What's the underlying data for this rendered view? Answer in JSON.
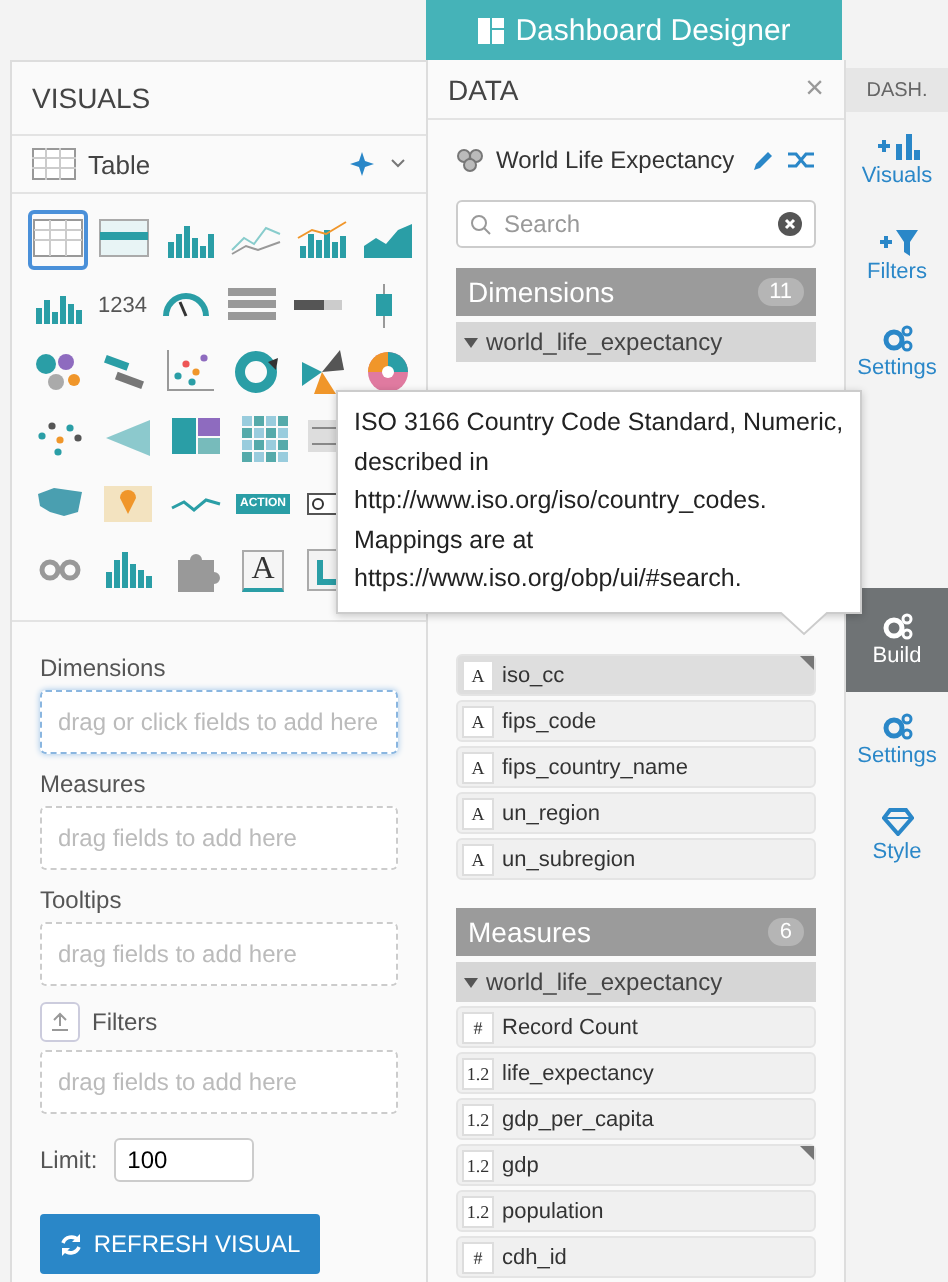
{
  "header": {
    "title": "Dashboard Designer"
  },
  "visuals_panel": {
    "title": "VISUALS",
    "current": "Table",
    "rows": [
      [
        {
          "kind": "table",
          "selected": true
        },
        {
          "kind": "cross-table",
          "selected": false
        },
        {
          "kind": "stacked-bars",
          "selected": false
        },
        {
          "kind": "lines",
          "selected": false
        },
        {
          "kind": "combo",
          "selected": false
        },
        {
          "kind": "area",
          "selected": false
        }
      ],
      [
        {
          "kind": "bars",
          "selected": false
        },
        {
          "kind": "kpi",
          "label": "1234",
          "selected": false
        },
        {
          "kind": "gauge",
          "selected": false
        },
        {
          "kind": "list",
          "selected": false
        },
        {
          "kind": "bullet",
          "selected": false
        },
        {
          "kind": "boxplot",
          "selected": false
        }
      ],
      [
        {
          "kind": "bubbles",
          "selected": false
        },
        {
          "kind": "word-cloud",
          "selected": false
        },
        {
          "kind": "scatter",
          "selected": false
        },
        {
          "kind": "donut",
          "selected": false
        },
        {
          "kind": "radial",
          "selected": false
        },
        {
          "kind": "sunburst",
          "selected": false
        }
      ],
      [
        {
          "kind": "network",
          "selected": false
        },
        {
          "kind": "funnel",
          "selected": false
        },
        {
          "kind": "treemap",
          "selected": false
        },
        {
          "kind": "heatmap",
          "selected": false
        },
        {
          "kind": "sankey",
          "selected": false
        }
      ],
      [
        {
          "kind": "map",
          "selected": false
        },
        {
          "kind": "pin-map",
          "selected": false
        },
        {
          "kind": "sparkline",
          "selected": false
        },
        {
          "kind": "action",
          "label": "ACTION",
          "selected": false
        },
        {
          "kind": "search-box",
          "selected": false
        }
      ],
      [
        {
          "kind": "chain",
          "selected": false
        },
        {
          "kind": "histogram",
          "selected": false
        },
        {
          "kind": "puzzle",
          "selected": false
        },
        {
          "kind": "rich-text",
          "label": "A",
          "selected": false
        },
        {
          "kind": "trellis",
          "selected": false
        }
      ]
    ],
    "shelves": [
      {
        "label": "Dimensions",
        "placeholder": "drag or click fields to add here",
        "focused": true,
        "kind": "plain"
      },
      {
        "label": "Measures",
        "placeholder": "drag fields to add here",
        "focused": false,
        "kind": "plain"
      },
      {
        "label": "Tooltips",
        "placeholder": "drag fields to add here",
        "focused": false,
        "kind": "plain"
      },
      {
        "label": "Filters",
        "placeholder": "drag fields to add here",
        "focused": false,
        "kind": "filter"
      }
    ],
    "limit": {
      "label": "Limit:",
      "value": "100"
    },
    "refresh_button": "REFRESH VISUAL"
  },
  "data_panel": {
    "title": "DATA",
    "close": "×",
    "dataset": "World Life Expectancy",
    "search": {
      "placeholder": "Search"
    },
    "dimensions": {
      "title": "Dimensions",
      "count": "11",
      "group": "world_life_expectancy",
      "fields": [
        {
          "type": "A",
          "name": "iso_cc",
          "hovered": true,
          "marked": true
        },
        {
          "type": "A",
          "name": "fips_code",
          "hovered": false,
          "marked": false
        },
        {
          "type": "A",
          "name": "fips_country_name",
          "hovered": false,
          "marked": false
        },
        {
          "type": "A",
          "name": "un_region",
          "hovered": false,
          "marked": false
        },
        {
          "type": "A",
          "name": "un_subregion",
          "hovered": false,
          "marked": false
        }
      ]
    },
    "measures": {
      "title": "Measures",
      "count": "6",
      "group": "world_life_expectancy",
      "fields": [
        {
          "type": "#",
          "name": "Record Count",
          "hovered": false,
          "marked": false
        },
        {
          "type": "1.2",
          "name": "life_expectancy",
          "hovered": false,
          "marked": false
        },
        {
          "type": "1.2",
          "name": "gdp_per_capita",
          "hovered": false,
          "marked": false
        },
        {
          "type": "1.2",
          "name": "gdp",
          "hovered": false,
          "marked": true
        },
        {
          "type": "1.2",
          "name": "population",
          "hovered": false,
          "marked": false
        },
        {
          "type": "#",
          "name": "cdh_id",
          "hovered": false,
          "marked": false
        }
      ]
    }
  },
  "side_tabs": {
    "header": "DASH.",
    "items": [
      {
        "label": "Visuals",
        "kind": "bars",
        "selected": false
      },
      {
        "label": "Filters",
        "kind": "filter",
        "selected": false
      },
      {
        "label": "Settings",
        "kind": "gears",
        "selected": false
      },
      {
        "label": "Build",
        "kind": "gears",
        "selected": true
      },
      {
        "label": "Settings",
        "kind": "gears",
        "selected": false
      },
      {
        "label": "Style",
        "kind": "diamond",
        "selected": false
      }
    ]
  },
  "tooltip": {
    "lines": [
      "ISO 3166 Country Code Standard, Numeric,",
      "described in",
      "http://www.iso.org/iso/country_codes.",
      "Mappings are at",
      "https://www.iso.org/obp/ui/#search."
    ]
  }
}
